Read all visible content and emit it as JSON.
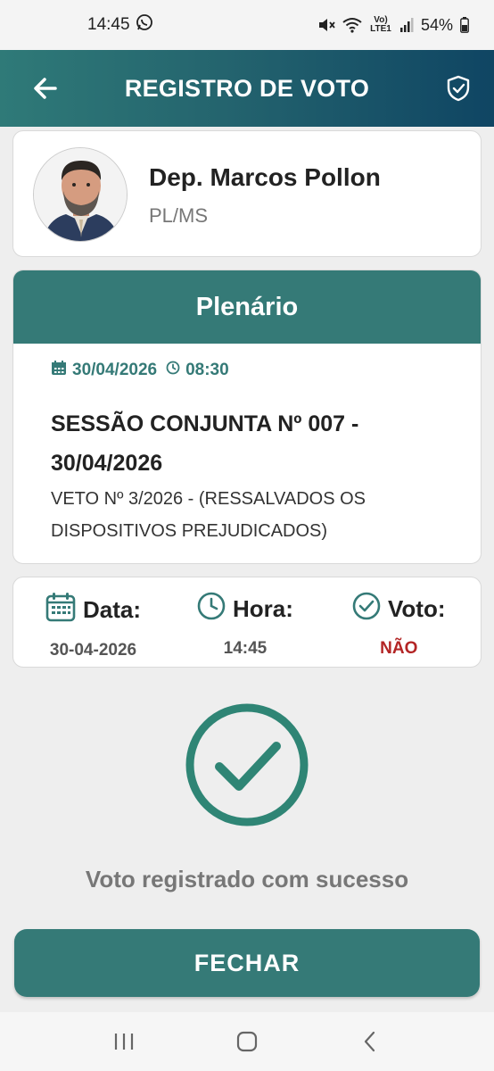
{
  "status_bar": {
    "time": "14:45",
    "network_label": "Vo) LTE1",
    "battery": "54%"
  },
  "header": {
    "title": "REGISTRO DE VOTO",
    "back_icon": "arrow-left-icon",
    "badge_icon": "shield-check-icon"
  },
  "deputy": {
    "name": "Dep. Marcos Pollon",
    "party": "PL/MS"
  },
  "session": {
    "location": "Plenário",
    "date": "30/04/2026",
    "time": "08:30",
    "title": "SESSÃO CONJUNTA Nº 007 - 30/04/2026",
    "description": "VETO Nº 3/2026 - (RESSALVADOS OS DISPOSITIVOS PREJUDICADOS)"
  },
  "vote_info": {
    "date_label": "Data:",
    "date_value": "30-04-2026",
    "time_label": "Hora:",
    "time_value": "14:45",
    "vote_label": "Voto:",
    "vote_value": "NÃO"
  },
  "result": {
    "message": "Voto registrado com sucesso",
    "close_label": "FECHAR"
  },
  "colors": {
    "primary": "#357a77",
    "header_dark": "#0f4563",
    "vote_no": "#b32525"
  }
}
